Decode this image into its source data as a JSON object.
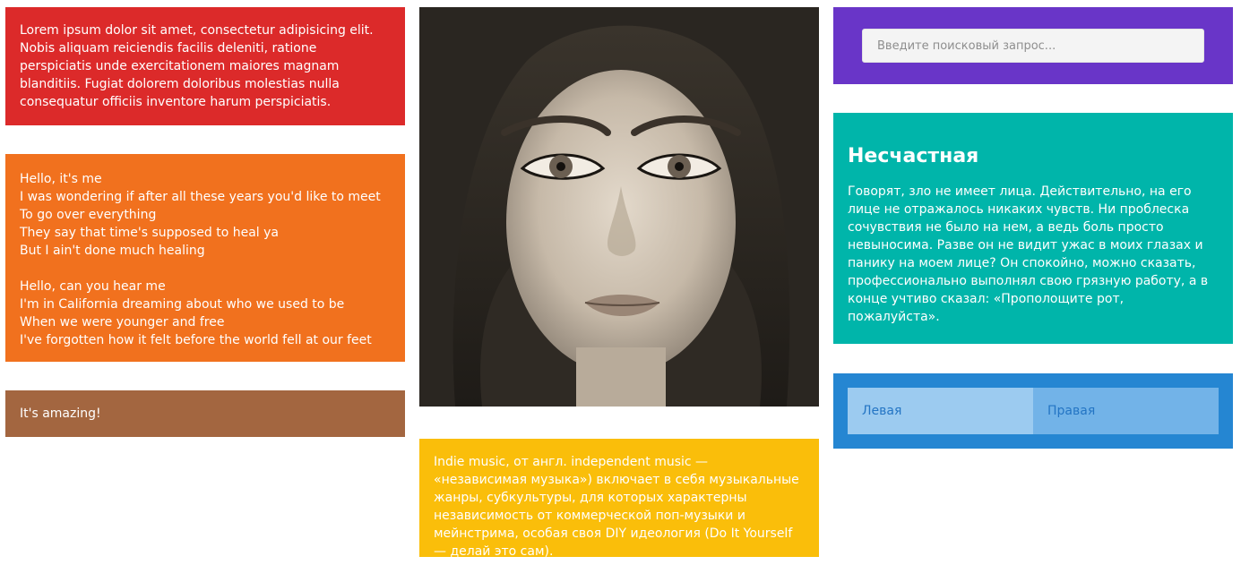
{
  "cards": {
    "lorem": {
      "text": "Lorem ipsum dolor sit amet, consectetur adipisicing elit. Nobis aliquam reiciendis facilis deleniti, ratione perspiciatis unde exercitationem maiores magnam blanditiis. Fugiat dolorem doloribus molestias nulla consequatur officiis inventore harum perspiciatis."
    },
    "lyrics": {
      "stanza1": [
        "Hello, it's me",
        "I was wondering if after all these years you'd like to meet",
        "To go over everything",
        "They say that time's supposed to heal ya",
        "But I ain't done much healing"
      ],
      "stanza2": [
        "Hello, can you hear me",
        "I'm in California dreaming about who we used to be",
        "When we were younger and free",
        "I've forgotten how it felt before the world fell at our feet"
      ]
    },
    "amazing": {
      "text": "It's amazing!"
    },
    "indie": {
      "text": "Indie music, от англ. independent music — «независимая музыка») включает в себя музыкальные жанры, субкультуры, для которых характерны независимость от коммерческой поп-музыки и мейнстрима, особая своя DIY идеология (Do It Yourself — делай это сам)."
    },
    "search": {
      "placeholder": "Введите поисковый запрос..."
    },
    "story": {
      "title": "Несчастная",
      "text": "Говорят, зло не имеет лица. Действительно, на его лице не отражалось никаких чувств. Ни проблеска сочувствия не было на нем, а ведь боль просто невыносима. Разве он не видит ужас в моих глазах и панику на моем лице? Он спокойно, можно сказать, профессионально выполнял свою грязную работу, а в конце учтиво сказал: «Прополощите рот, пожалуйста»."
    },
    "split": {
      "left": "Левая",
      "right": "Правая"
    }
  },
  "colors": {
    "red": "#dc2a2a",
    "orange": "#f1711e",
    "brown": "#a36640",
    "yellow": "#fabe0a",
    "purple": "#6935c8",
    "teal": "#00b5aa",
    "blue": "#2586d2"
  },
  "image": {
    "kind": "portrait-photo",
    "tone": "sepia-monochrome"
  }
}
